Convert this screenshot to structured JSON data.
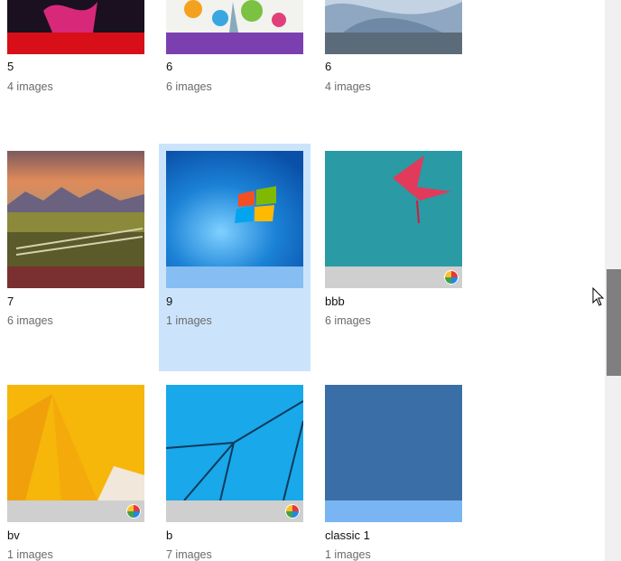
{
  "themes": [
    {
      "name": "5",
      "count": "4 images",
      "strip_color": "#d80e18",
      "has_color_icon": false
    },
    {
      "name": "6",
      "count": "6 images",
      "strip_color": "#7b3fb0",
      "has_color_icon": false
    },
    {
      "name": "6",
      "count": "4 images",
      "strip_color": "#5b6b7a",
      "has_color_icon": false
    },
    {
      "name": "7",
      "count": "6 images",
      "strip_color": "#7a3030",
      "has_color_icon": false
    },
    {
      "name": "9",
      "count": "1 images",
      "strip_color": "#86bdf2",
      "has_color_icon": false,
      "selected": true
    },
    {
      "name": "bbb",
      "count": "6 images",
      "strip_color": "#cfcfcf",
      "has_color_icon": true
    },
    {
      "name": "bv",
      "count": "1 images",
      "strip_color": "#cfcfcf",
      "has_color_icon": true
    },
    {
      "name": "b",
      "count": "7 images",
      "strip_color": "#cfcfcf",
      "has_color_icon": true
    },
    {
      "name": "classic 1",
      "count": "1 images",
      "strip_color": "#79b5f2",
      "has_color_icon": false
    }
  ],
  "icons": {
    "color_icon": "color-wheel-icon",
    "cursor": "mouse-pointer-icon"
  },
  "scrollbar": {
    "position_fraction": 0.48
  }
}
